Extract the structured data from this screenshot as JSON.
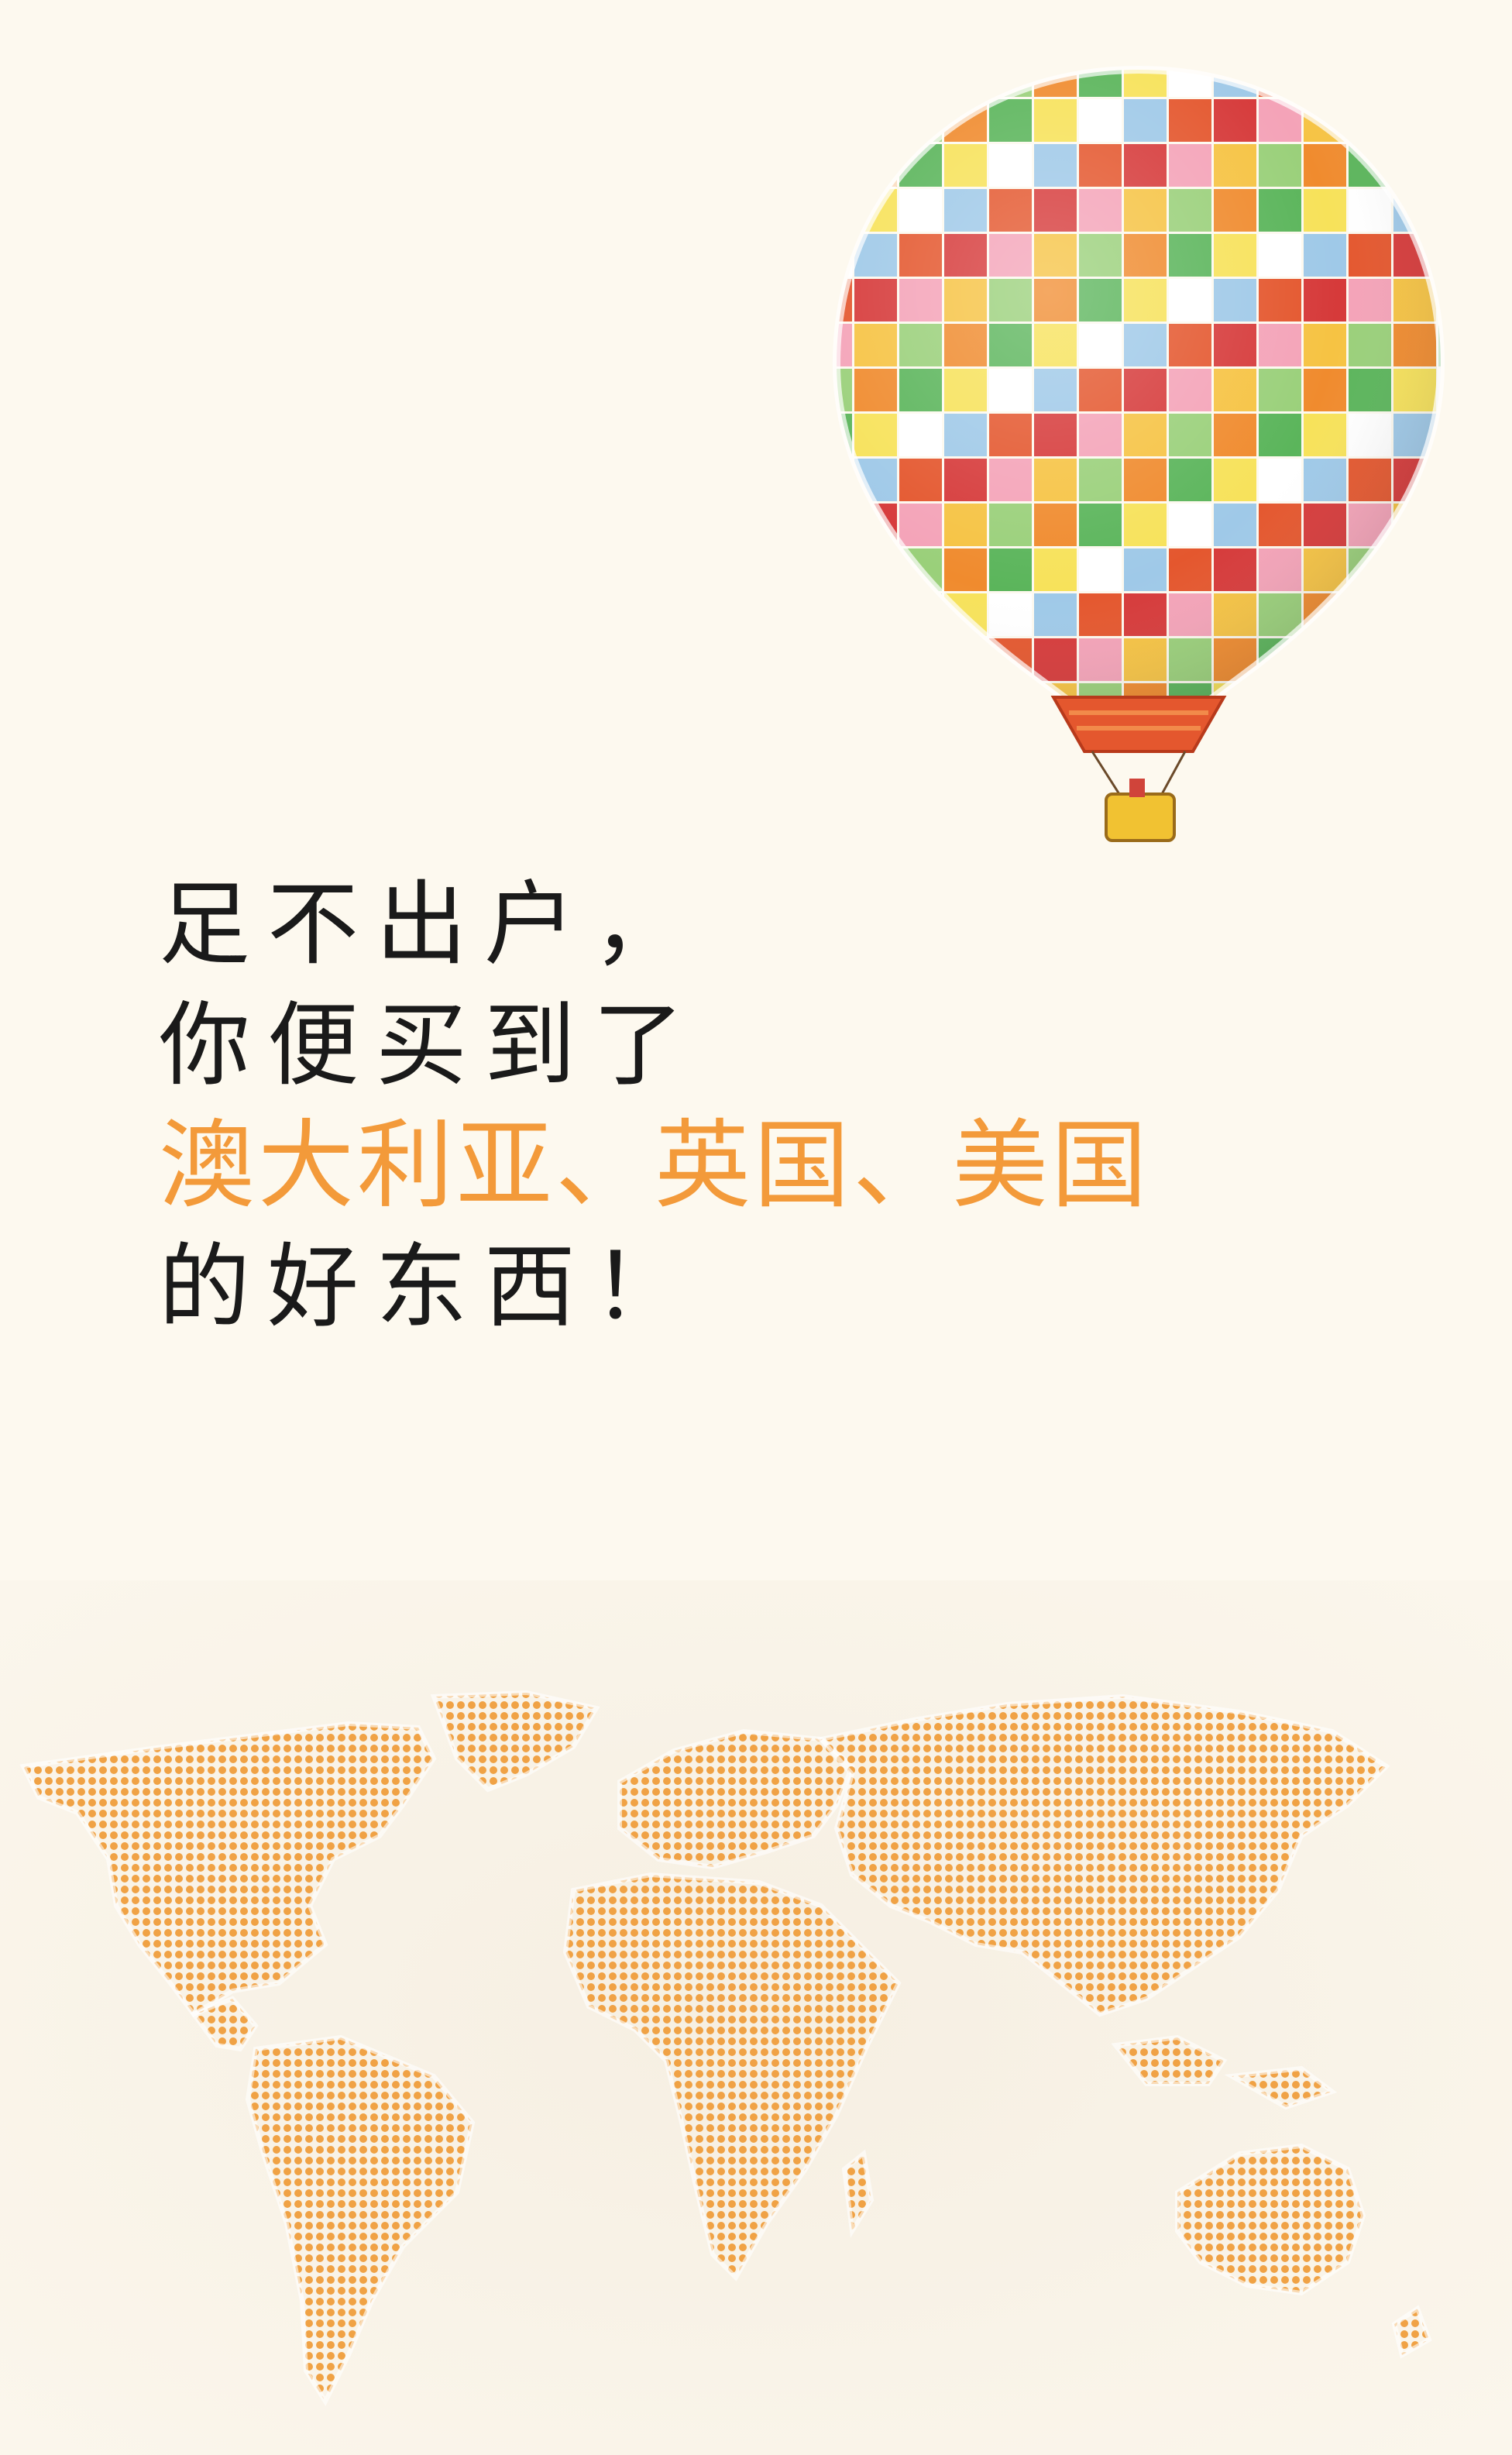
{
  "headline": {
    "line1": "足不出户，",
    "line2": "你便买到了",
    "line3": "澳大利亚、英国、美国",
    "line4": "的好东西！"
  },
  "colors": {
    "background": "#fdf9ef",
    "accent": "#f39a3a",
    "text": "#1a1a1a",
    "map_dot": "#f0a245"
  },
  "illustrations": {
    "balloon": "hot-air-balloon-illustration",
    "map": "dotted-world-map-illustration"
  }
}
